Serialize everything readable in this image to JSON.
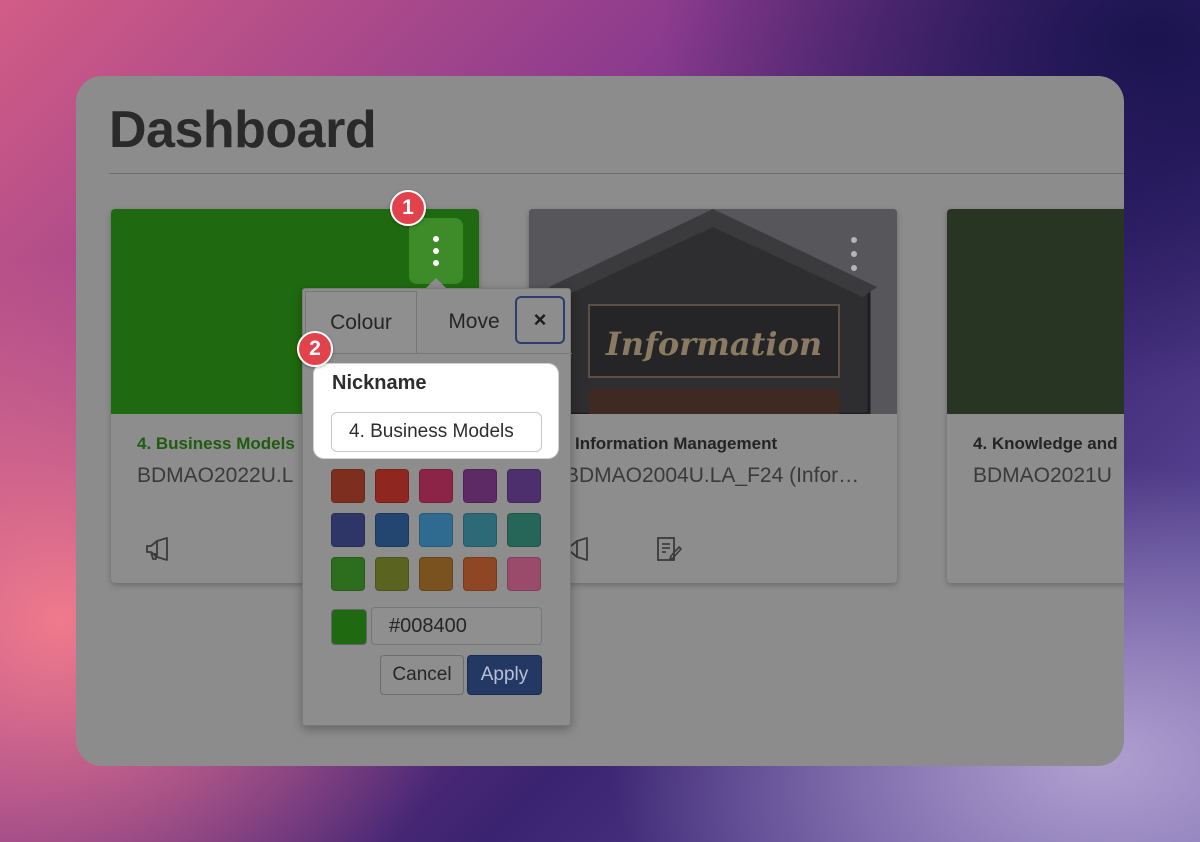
{
  "page": {
    "title": "Dashboard"
  },
  "cards": [
    {
      "name": "4. Business Models",
      "code": "BDMAO2022U.L",
      "color": "#1f6a10",
      "icons": [
        "megaphone-icon"
      ]
    },
    {
      "name": "Information Management",
      "code": "BDMAO2004U.LA_F24 (Infor…",
      "image_caption": "Information",
      "icons": [
        "megaphone-icon",
        "assignment-icon"
      ]
    },
    {
      "name": "4. Knowledge and",
      "code": "BDMAO2021U",
      "color": "#283522",
      "icons": []
    }
  ],
  "step_badges": [
    "1",
    "2"
  ],
  "popover": {
    "tabs": [
      "Colour",
      "Move"
    ],
    "close_label": "×",
    "nickname_label": "Nickname",
    "nickname_value": "4. Business Models",
    "swatches": [
      "#7e2e1e",
      "#8f2620",
      "#8c2448",
      "#5e2a66",
      "#4c2f6c",
      "#2e3668",
      "#224670",
      "#2f6a90",
      "#2c6a78",
      "#266658",
      "#2d6e1e",
      "#5a6420",
      "#7a5220",
      "#8e4624",
      "#9a4a6a"
    ],
    "selected_color": "#1f6a10",
    "hex_value": "#008400",
    "cancel_label": "Cancel",
    "apply_label": "Apply"
  }
}
